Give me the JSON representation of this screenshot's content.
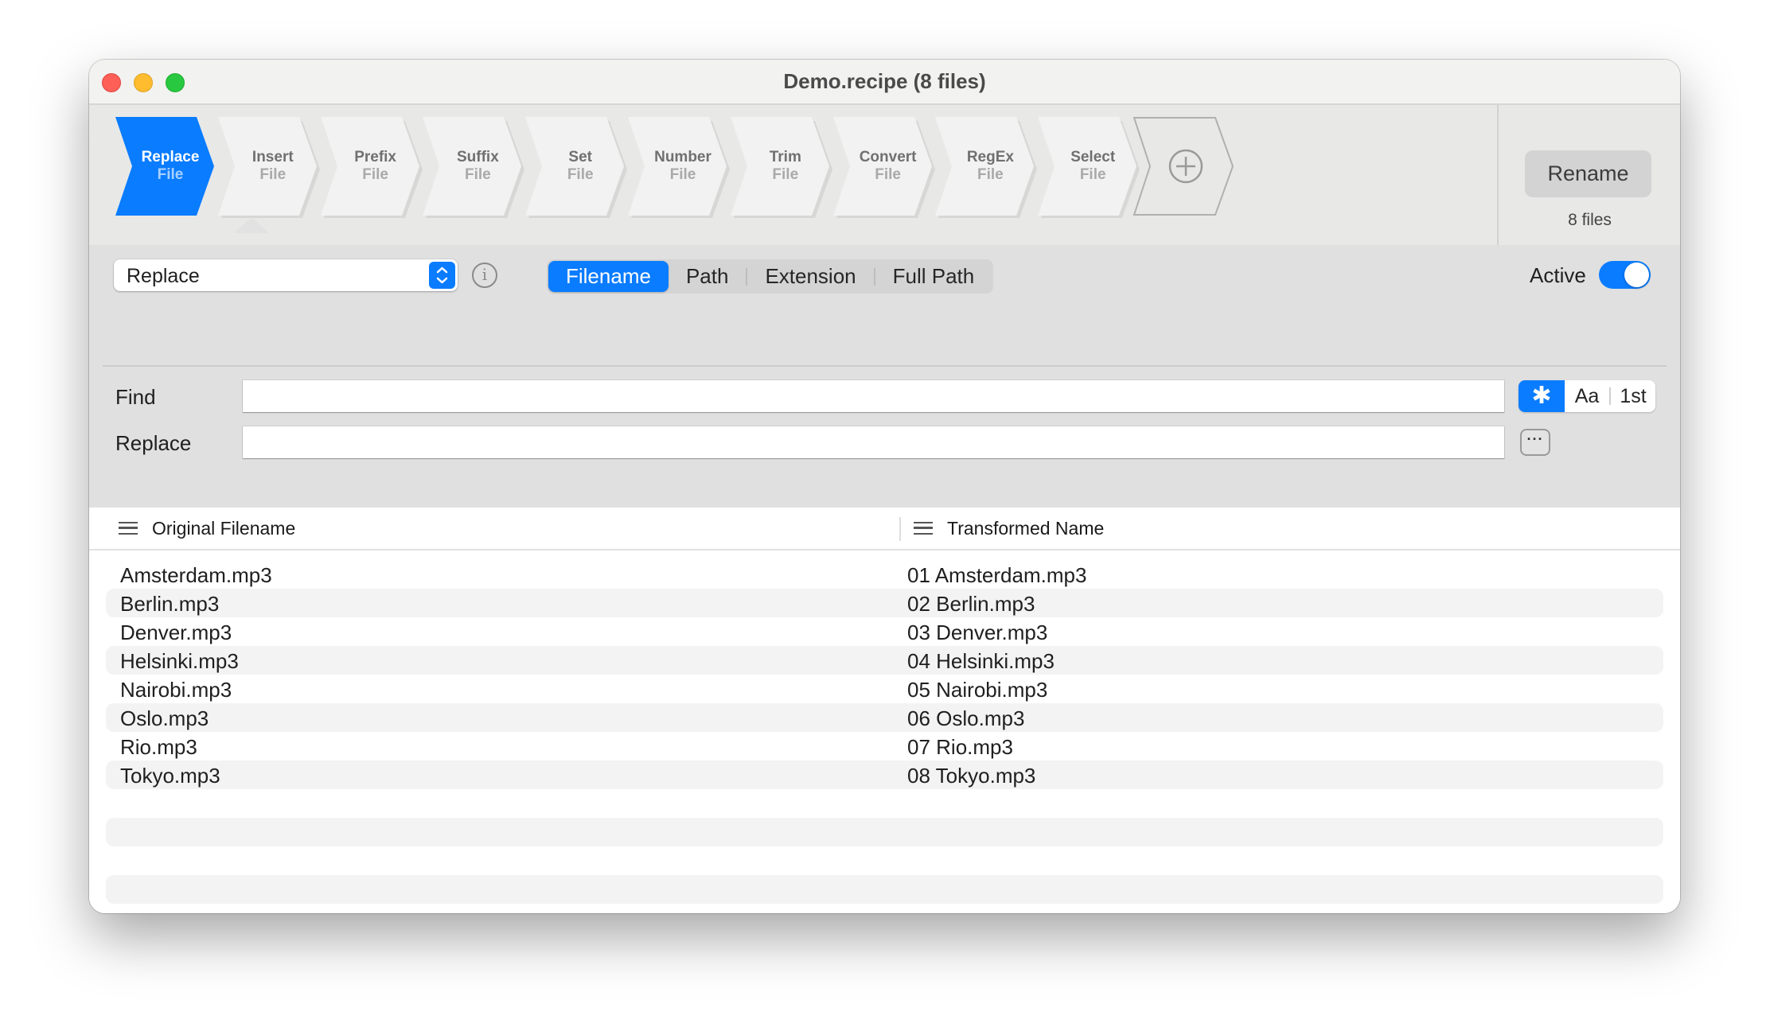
{
  "window": {
    "title": "Demo.recipe (8 files)"
  },
  "toolbar": {
    "actions": [
      {
        "label": "Replace",
        "sub": "File",
        "active": true
      },
      {
        "label": "Insert",
        "sub": "File",
        "active": false
      },
      {
        "label": "Prefix",
        "sub": "File",
        "active": false
      },
      {
        "label": "Suffix",
        "sub": "File",
        "active": false
      },
      {
        "label": "Set",
        "sub": "File",
        "active": false
      },
      {
        "label": "Number",
        "sub": "File",
        "active": false
      },
      {
        "label": "Trim",
        "sub": "File",
        "active": false
      },
      {
        "label": "Convert",
        "sub": "File",
        "active": false
      },
      {
        "label": "RegEx",
        "sub": "File",
        "active": false
      },
      {
        "label": "Select",
        "sub": "File",
        "active": false
      }
    ],
    "add_icon": "plus-circle-icon",
    "rename_label": "Rename",
    "file_count": "8 files"
  },
  "config": {
    "mode": "Replace",
    "targets": [
      "Filename",
      "Path",
      "Extension",
      "Full Path"
    ],
    "selected_target": "Filename",
    "active_label": "Active",
    "active": true,
    "find_label": "Find",
    "find_value": "",
    "replace_label": "Replace",
    "replace_value": "",
    "options": [
      {
        "label": "✱",
        "name": "wildcard",
        "on": true
      },
      {
        "label": "Aa",
        "name": "case-sensitive",
        "on": false
      },
      {
        "label": "1st",
        "name": "first-only",
        "on": false
      }
    ],
    "more_label": "···"
  },
  "list": {
    "columns": [
      "Original Filename",
      "Transformed Name"
    ],
    "rows": [
      [
        "Amsterdam.mp3",
        "01 Amsterdam.mp3"
      ],
      [
        "Berlin.mp3",
        "02 Berlin.mp3"
      ],
      [
        "Denver.mp3",
        "03 Denver.mp3"
      ],
      [
        "Helsinki.mp3",
        "04 Helsinki.mp3"
      ],
      [
        "Nairobi.mp3",
        "05 Nairobi.mp3"
      ],
      [
        "Oslo.mp3",
        "06 Oslo.mp3"
      ],
      [
        "Rio.mp3",
        "07 Rio.mp3"
      ],
      [
        "Tokyo.mp3",
        "08 Tokyo.mp3"
      ]
    ],
    "empty_rows": 4
  },
  "colors": {
    "accent": "#0a7cff",
    "toolbar_bg": "#e8e8e7",
    "config_bg": "#e0e0e0",
    "stripe": "#f3f3f3"
  }
}
